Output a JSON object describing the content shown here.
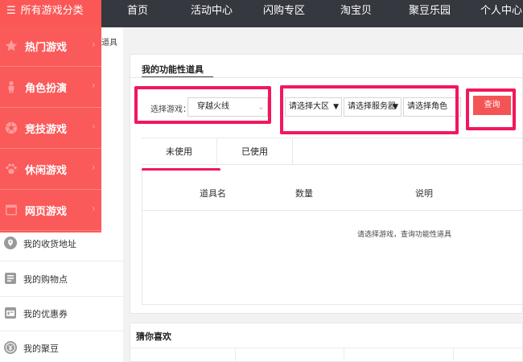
{
  "nav": {
    "category_title": "所有游戏分类",
    "items": [
      "首页",
      "活动中心",
      "闪购专区",
      "淘宝贝",
      "聚豆乐园",
      "个人中心"
    ]
  },
  "category_menu": [
    {
      "label": "热门游戏",
      "icon": "star-icon"
    },
    {
      "label": "角色扮演",
      "icon": "person-icon"
    },
    {
      "label": "竞技游戏",
      "icon": "soccer-ball-icon"
    },
    {
      "label": "休闲游戏",
      "icon": "paw-icon"
    },
    {
      "label": "网页游戏",
      "icon": "browser-window-icon"
    }
  ],
  "breadcrumb_tail": "道具",
  "sidebar": {
    "items": [
      {
        "label": "我的收货地址",
        "icon": "location-pin-icon"
      },
      {
        "label": "我的购物点",
        "icon": "receipt-icon"
      },
      {
        "label": "我的优惠券",
        "icon": "coupon-icon"
      },
      {
        "label": "我的聚豆",
        "icon": "yen-coin-icon"
      }
    ]
  },
  "main": {
    "title": "我的功能性道具",
    "game_label": "选择游戏：",
    "game_value": "穿越火线",
    "region_value": "请选择大区",
    "server_value": "请选择服务器",
    "role_value": "请选择角色",
    "query_button": "查询",
    "tabs": [
      "未使用",
      "已使用"
    ],
    "table_headers": [
      "道具名",
      "数量",
      "说明"
    ],
    "empty_message": "请选择游戏，查询功能性道具"
  },
  "guess": {
    "title": "猜你喜欢"
  },
  "colors": {
    "accent": "#fa5a5a",
    "highlight": "#f2175d",
    "topbar": "#35383f"
  }
}
